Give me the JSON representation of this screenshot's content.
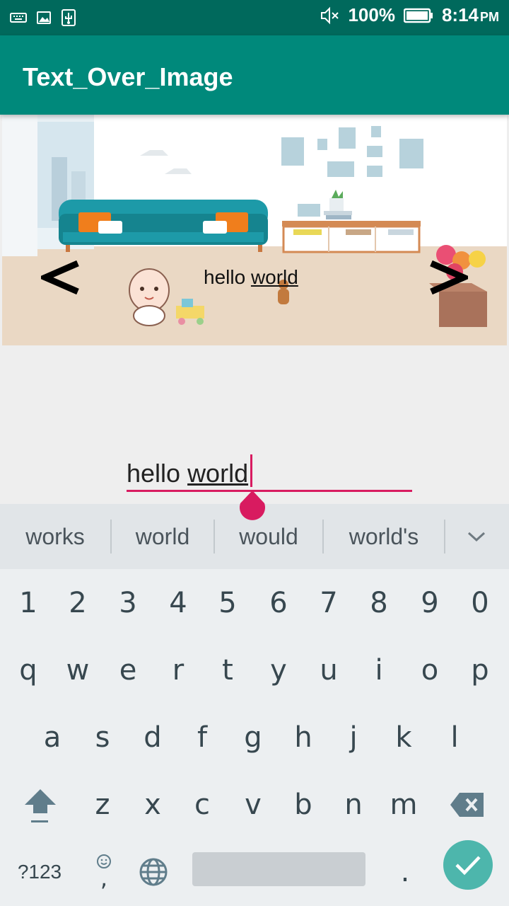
{
  "status_bar": {
    "battery": "100%",
    "time": "8:14",
    "ampm": "PM"
  },
  "app_bar": {
    "title": "Text_Over_Image"
  },
  "image_view": {
    "overlay_text_plain": "hello ",
    "overlay_text_underlined": "world",
    "prev_label": "<",
    "next_label": ">"
  },
  "edit_field": {
    "value_plain": "hello ",
    "value_underlined": "world"
  },
  "suggestions": [
    "works",
    "world",
    "would",
    "world's"
  ],
  "keyboard": {
    "row_numbers": [
      "1",
      "2",
      "3",
      "4",
      "5",
      "6",
      "7",
      "8",
      "9",
      "0"
    ],
    "row_1": [
      "q",
      "w",
      "e",
      "r",
      "t",
      "y",
      "u",
      "i",
      "o",
      "p"
    ],
    "row_2": [
      "a",
      "s",
      "d",
      "f",
      "g",
      "h",
      "j",
      "k",
      "l"
    ],
    "row_3": [
      "z",
      "x",
      "c",
      "v",
      "b",
      "n",
      "m"
    ],
    "symbols_label": "?123",
    "comma_label": ",",
    "period_label": "."
  },
  "colors": {
    "status_bar": "#00695c",
    "app_bar": "#00897b",
    "accent": "#d81b60",
    "enter_key": "#4db6ac"
  }
}
